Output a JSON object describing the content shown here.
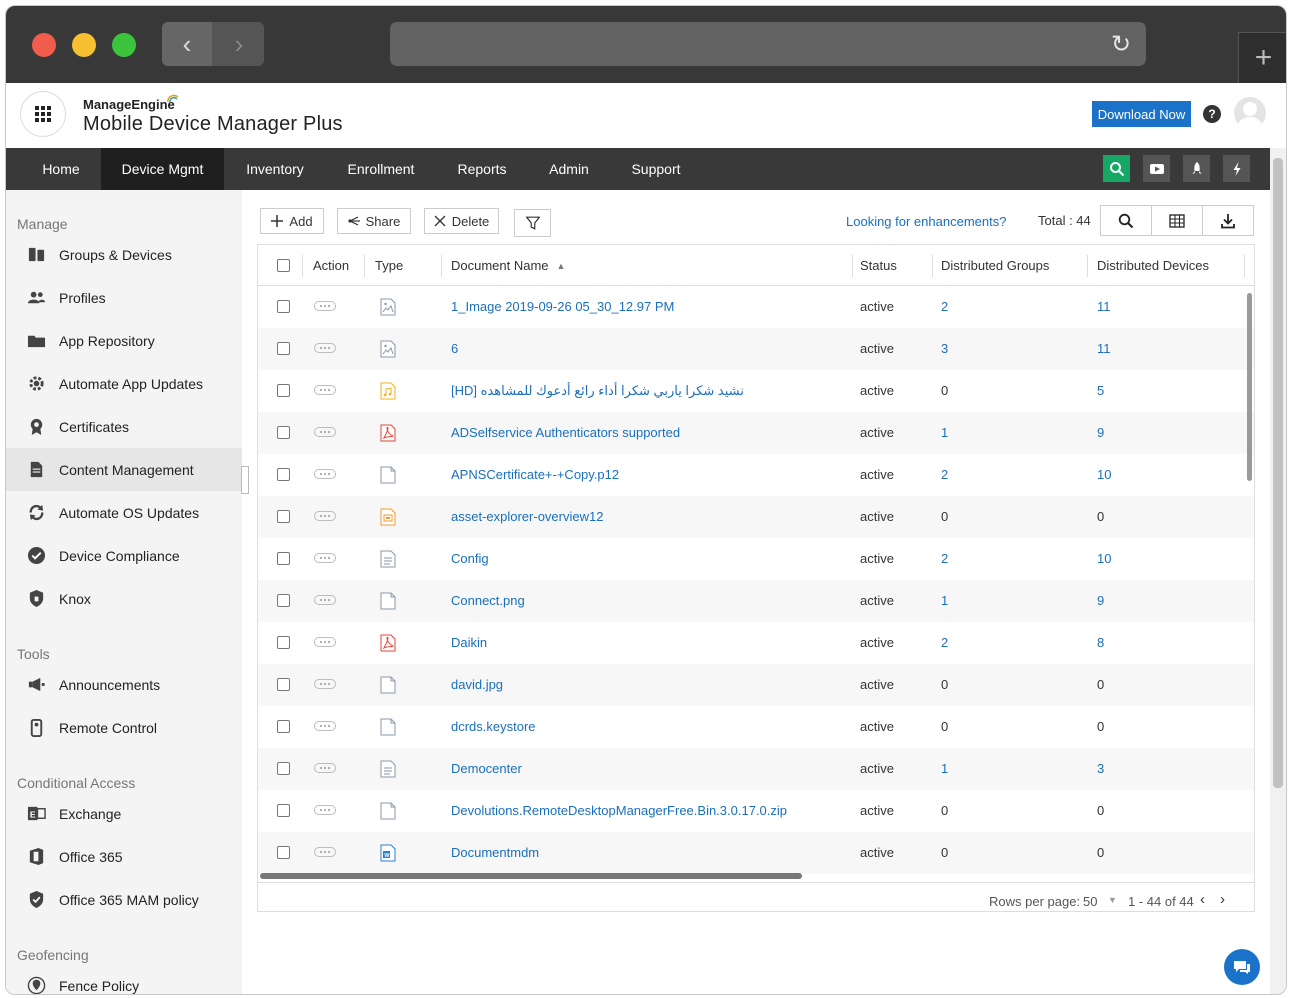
{
  "app": {
    "brand_top": "ManageEngine",
    "brand_name": "Mobile Device Manager Plus",
    "download_label": "Download Now",
    "help_label": "?"
  },
  "nav": {
    "items": [
      "Home",
      "Device Mgmt",
      "Inventory",
      "Enrollment",
      "Reports",
      "Admin",
      "Support"
    ],
    "active": "Device Mgmt"
  },
  "sidebar": {
    "manage_heading": "Manage",
    "manage_items": [
      "Groups & Devices",
      "Profiles",
      "App Repository",
      "Automate App Updates",
      "Certificates",
      "Content Management",
      "Automate OS Updates",
      "Device Compliance",
      "Knox"
    ],
    "active_item": "Content Management",
    "tools_heading": "Tools",
    "tools_items": [
      "Announcements",
      "Remote Control"
    ],
    "ca_heading": "Conditional Access",
    "ca_items": [
      "Exchange",
      "Office 365",
      "Office 365 MAM policy"
    ],
    "geo_heading": "Geofencing",
    "geo_items": [
      "Fence Policy"
    ]
  },
  "toolbar": {
    "add_label": "Add",
    "share_label": "Share",
    "delete_label": "Delete",
    "enhancements_link": "Looking for enhancements?",
    "total_label": "Total : 44"
  },
  "table": {
    "columns": [
      "Action",
      "Type",
      "Document Name",
      "Status",
      "Distributed Groups",
      "Distributed Devices"
    ],
    "rows": [
      {
        "type": "image",
        "name": "1_Image 2019-09-26 05_30_12.97 PM",
        "status": "active",
        "groups": "2",
        "devices": "11"
      },
      {
        "type": "image",
        "name": "6",
        "status": "active",
        "groups": "3",
        "devices": "11"
      },
      {
        "type": "audio",
        "name": "[HD] نشيد شكرا ياربي شكرا أداء رائع أدعوك للمشاهده",
        "status": "active",
        "groups": "0",
        "devices": "5"
      },
      {
        "type": "pdf",
        "name": "ADSelfservice Authenticators supported",
        "status": "active",
        "groups": "1",
        "devices": "9"
      },
      {
        "type": "file",
        "name": "APNSCertificate+-+Copy.p12",
        "status": "active",
        "groups": "2",
        "devices": "10"
      },
      {
        "type": "ppt",
        "name": "asset-explorer-overview12",
        "status": "active",
        "groups": "0",
        "devices": "0"
      },
      {
        "type": "text",
        "name": "Config",
        "status": "active",
        "groups": "2",
        "devices": "10"
      },
      {
        "type": "file",
        "name": "Connect.png",
        "status": "active",
        "groups": "1",
        "devices": "9"
      },
      {
        "type": "pdf",
        "name": "Daikin",
        "status": "active",
        "groups": "2",
        "devices": "8"
      },
      {
        "type": "file",
        "name": "david.jpg",
        "status": "active",
        "groups": "0",
        "devices": "0"
      },
      {
        "type": "file",
        "name": "dcrds.keystore",
        "status": "active",
        "groups": "0",
        "devices": "0"
      },
      {
        "type": "text",
        "name": "Democenter",
        "status": "active",
        "groups": "1",
        "devices": "3"
      },
      {
        "type": "file",
        "name": "Devolutions.RemoteDesktopManagerFree.Bin.3.0.17.0.zip",
        "status": "active",
        "groups": "0",
        "devices": "0"
      },
      {
        "type": "word",
        "name": "Documentmdm",
        "status": "active",
        "groups": "0",
        "devices": "0"
      }
    ]
  },
  "footer": {
    "rows_per_page_label": "Rows per page:",
    "rows_per_page_value": "50",
    "range": "1 - 44 of 44"
  },
  "colors": {
    "link": "#1a6fbf",
    "nav_bg": "#393939",
    "nav_active": "#1f1f1f",
    "download_bg": "#1a73c8",
    "search_icon_bg": "#16a765"
  }
}
